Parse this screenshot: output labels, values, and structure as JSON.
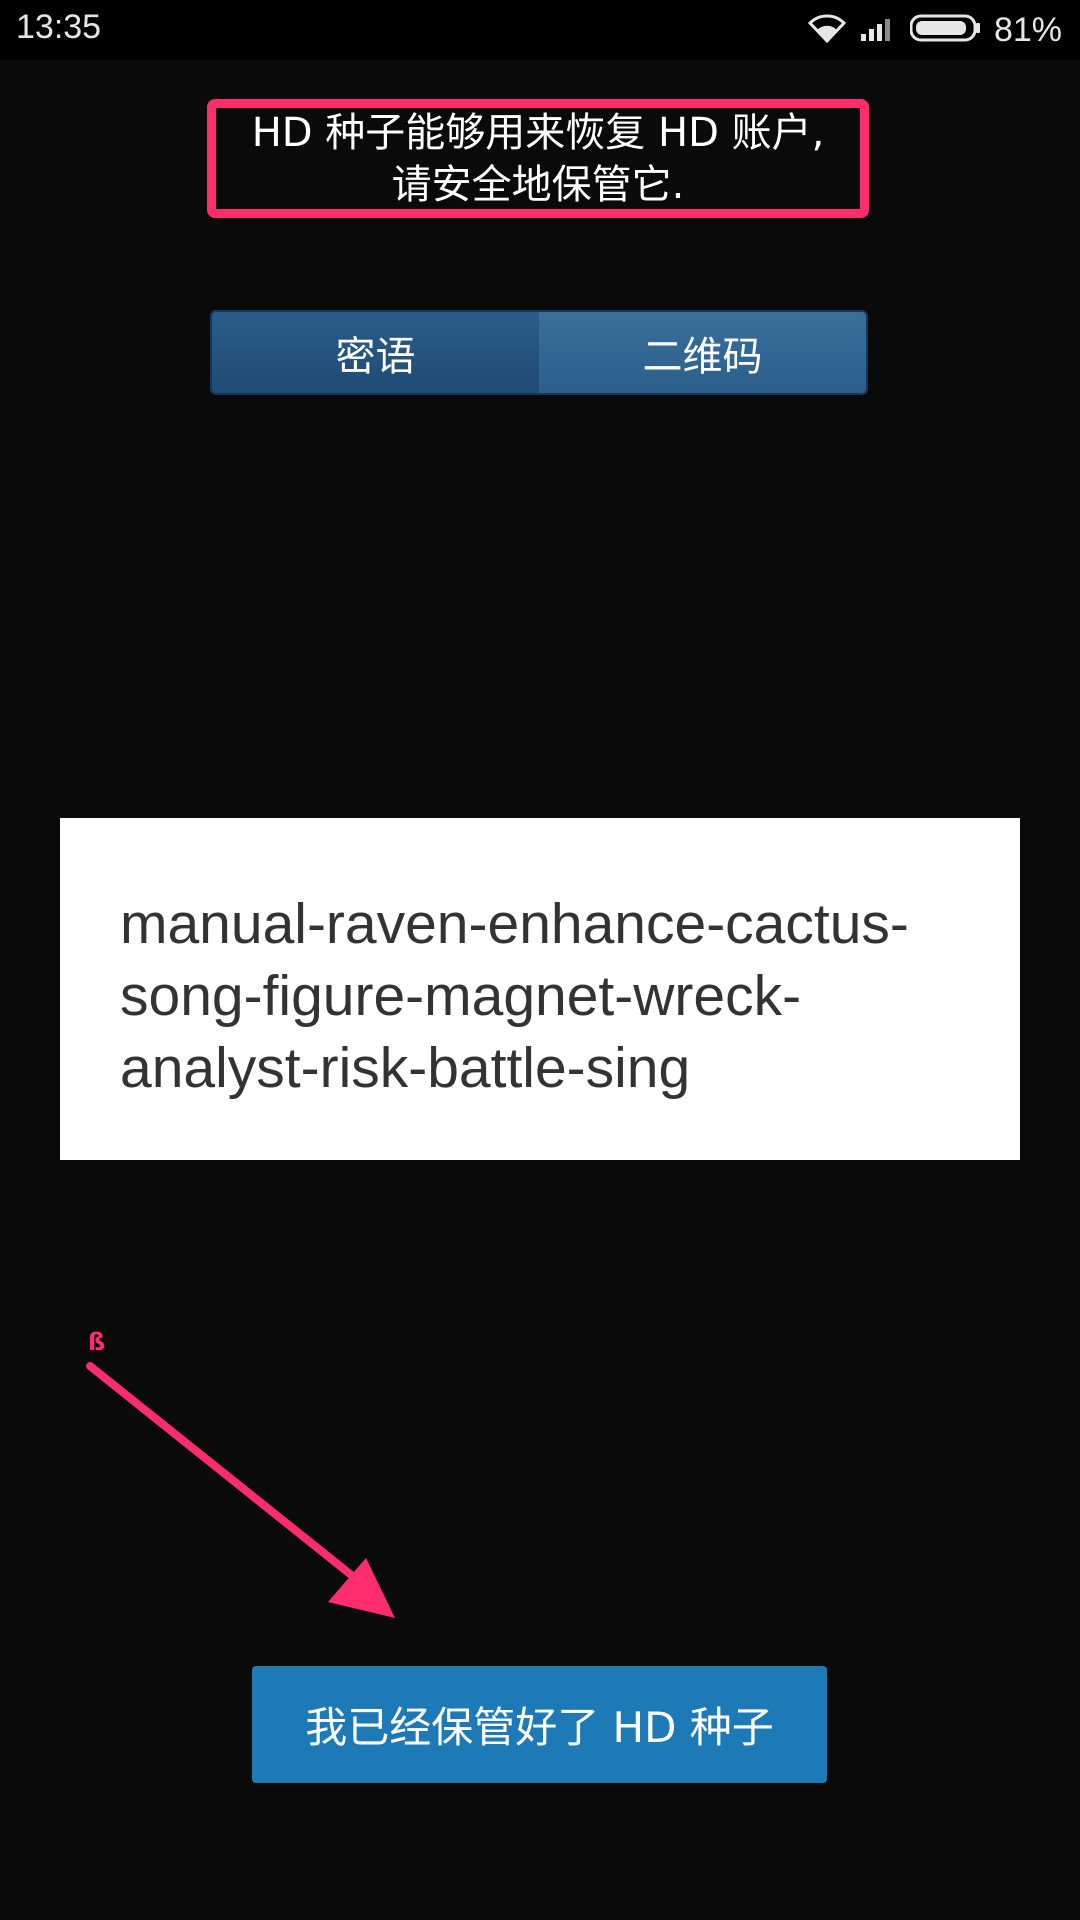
{
  "status_bar": {
    "time": "13:35",
    "battery": "81%",
    "icons": [
      "wifi-icon",
      "signal-icon",
      "battery-icon"
    ]
  },
  "header": {
    "line1": "HD 种子能够用来恢复 HD 账户,",
    "line2": "请安全地保管它."
  },
  "tabs": [
    {
      "label": "密语"
    },
    {
      "label": "二维码"
    }
  ],
  "passphrase": {
    "text": "manual-raven-enhance-cactus-song-figure-magnet-wreck-analyst-risk-battle-sing"
  },
  "annotation": {
    "mark": "ß"
  },
  "confirm_button": {
    "label": "我已经保管好了 HD 种子"
  },
  "colors": {
    "background": "#0a0a0a",
    "highlight": "#ff2d6e",
    "button": "#1e7ab6",
    "tab_dark": "#1f4b74",
    "tab_light": "#2b5f8c"
  }
}
